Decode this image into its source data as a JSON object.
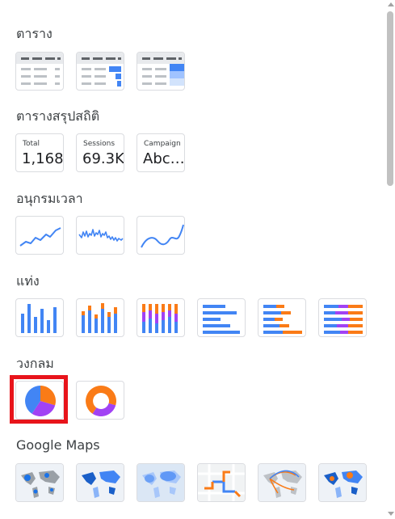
{
  "sections": {
    "table": {
      "title": "ตาราง"
    },
    "scorecard": {
      "title": "ตารางสรุปสถิติ",
      "cards": [
        {
          "label": "Total",
          "value": "1,168"
        },
        {
          "label": "Sessions",
          "value": "69.3K"
        },
        {
          "label": "Campaign",
          "value": "Abc…"
        }
      ]
    },
    "timeseries": {
      "title": "อนุกรมเวลา"
    },
    "bar": {
      "title": "แท่ง"
    },
    "pie": {
      "title": "วงกลม"
    },
    "geo": {
      "title": "Google Maps"
    }
  },
  "colors": {
    "blue": "#4285f4",
    "orange": "#fa7b17",
    "purple": "#a142f4",
    "selection": "#e8141b"
  },
  "selected_tile": "pie-chart"
}
